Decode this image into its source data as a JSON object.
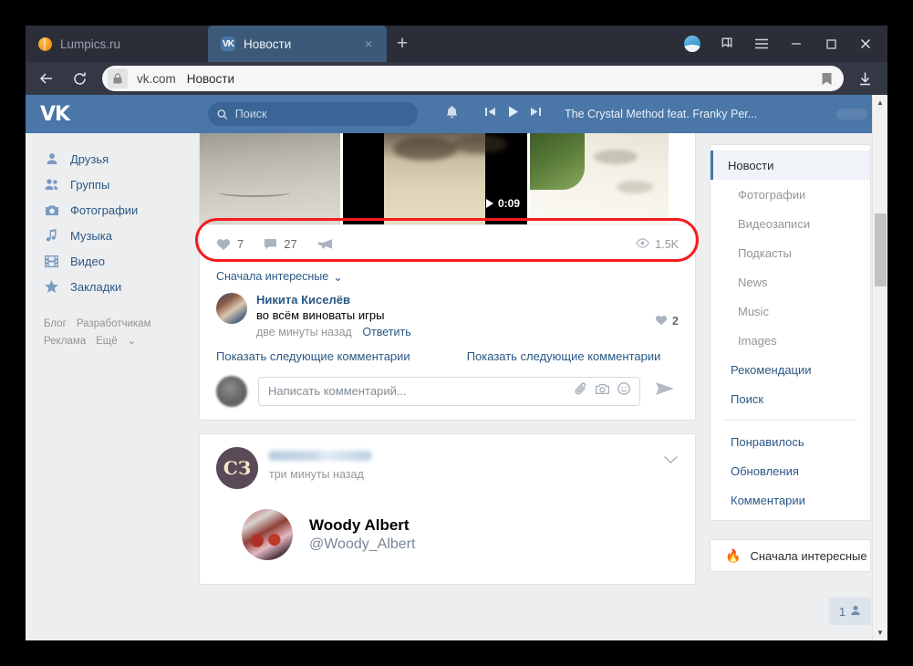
{
  "browser": {
    "tabs": [
      {
        "title": "Lumpics.ru",
        "icon": "lumpics-favicon",
        "active": false
      },
      {
        "title": "Новости",
        "icon": "vk-favicon",
        "active": true,
        "close_label": "×"
      }
    ],
    "new_tab_label": "+",
    "toolbar_icons": {
      "back": "←",
      "reload": "⟳",
      "lock": "lock-icon",
      "bookmark": "bookmark-icon",
      "download": "download-icon",
      "profile": "profile-avatar-icon",
      "collections": "collections-icon",
      "menu": "hamburger-menu-icon",
      "minimize": "—",
      "maximize": "▢",
      "close": "✕"
    },
    "address": {
      "domain": "vk.com",
      "page_title": "Новости"
    }
  },
  "vk_header": {
    "logo": "VK",
    "search_placeholder": "Поиск",
    "search_value": "",
    "notifications_icon": "bell-icon",
    "audio": {
      "prev_icon": "skip-previous-icon",
      "play_icon": "play-icon",
      "next_icon": "skip-next-icon",
      "track": "The Crystal Method feat. Franky Per..."
    },
    "accent_color": "#4a76a8"
  },
  "left_nav": {
    "items": [
      {
        "label": "Друзья",
        "icon": "person-icon"
      },
      {
        "label": "Группы",
        "icon": "people-icon"
      },
      {
        "label": "Фотографии",
        "icon": "camera-icon"
      },
      {
        "label": "Музыка",
        "icon": "music-note-icon"
      },
      {
        "label": "Видео",
        "icon": "film-icon"
      },
      {
        "label": "Закладки",
        "icon": "star-icon"
      }
    ],
    "footer_links": [
      "Блог",
      "Разработчикам",
      "Реклама",
      "Ещё"
    ]
  },
  "feed": {
    "post1": {
      "media": [
        {
          "type": "photo",
          "alt": "road"
        },
        {
          "type": "video",
          "alt": "gravel path",
          "duration": "0:09"
        },
        {
          "type": "photo",
          "alt": "shaded path"
        }
      ],
      "actions": {
        "likes_icon": "heart-icon",
        "likes": "7",
        "comments_icon": "comment-icon",
        "comments": "27",
        "share_icon": "share-megaphone-icon",
        "views_icon": "eye-icon",
        "views": "1.5K"
      },
      "highlight_color": "#f61c1c",
      "comments_section": {
        "sort_label": "Сначала интересные",
        "sort_chevron": "chevron-down-icon",
        "items": [
          {
            "author": "Никита Киселёв",
            "text": "во всём виноваты игры",
            "time": "две минуты назад",
            "reply_label": "Ответить",
            "likes": "2",
            "likes_icon": "heart-icon"
          }
        ],
        "show_more_left": "Показать следующие комментарии",
        "show_more_right": "Показать следующие комментарии",
        "composer": {
          "placeholder": "Написать комментарий...",
          "value": "",
          "attach_icon": "paperclip-icon",
          "photo_icon": "camera-icon",
          "emoji_icon": "smiley-icon",
          "send_icon": "send-arrow-icon"
        }
      }
    },
    "post2": {
      "avatar_initials": "СЗ",
      "author_name": "",
      "time": "три минуты назад",
      "menu_icon": "chevron-down-icon",
      "attachment": {
        "name": "Woody Albert",
        "handle": "@Woody_Albert"
      }
    }
  },
  "right_nav": {
    "items": [
      {
        "label": "Новости",
        "active": true,
        "sub": false
      },
      {
        "label": "Фотографии",
        "active": false,
        "sub": true
      },
      {
        "label": "Видеозаписи",
        "active": false,
        "sub": true
      },
      {
        "label": "Подкасты",
        "active": false,
        "sub": true
      },
      {
        "label": "News",
        "active": false,
        "sub": true
      },
      {
        "label": "Music",
        "active": false,
        "sub": true
      },
      {
        "label": "Images",
        "active": false,
        "sub": true
      },
      {
        "label": "Рекомендации",
        "active": false,
        "sub": false
      },
      {
        "label": "Поиск",
        "active": false,
        "sub": false
      }
    ],
    "items2": [
      {
        "label": "Понравилось"
      },
      {
        "label": "Обновления"
      },
      {
        "label": "Комментарии"
      }
    ],
    "sort_card": {
      "icon": "flame-icon",
      "label": "Сначала интересные"
    },
    "online_counter": {
      "count": "1",
      "icon": "person-icon"
    }
  }
}
